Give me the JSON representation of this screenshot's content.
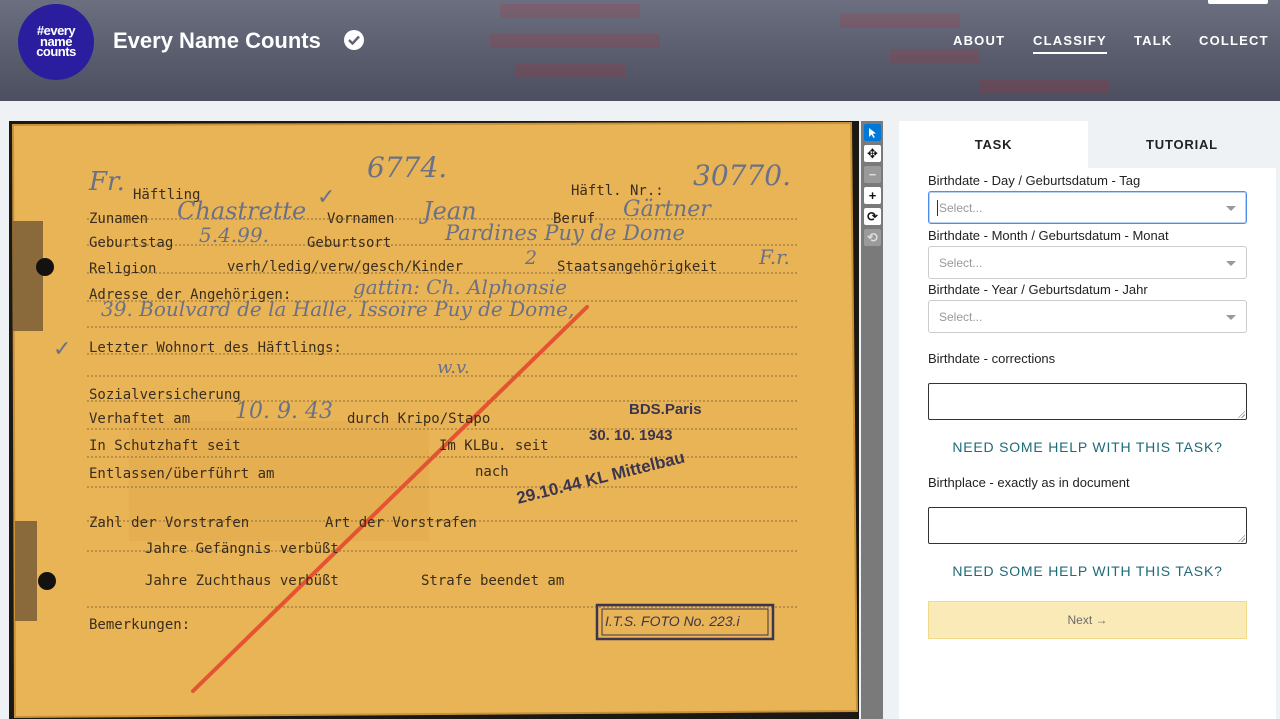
{
  "header": {
    "logo_lines": [
      "#every",
      "name",
      "counts"
    ],
    "project_title": "Every Name Counts",
    "nav": [
      "ABOUT",
      "CLASSIFY",
      "TALK",
      "COLLECT"
    ],
    "active_nav": "CLASSIFY"
  },
  "toolbar": {
    "tools": [
      "pointer",
      "move",
      "zoom-out",
      "zoom-in",
      "rotate",
      "reset"
    ]
  },
  "document": {
    "printed": {
      "haeftling": "Häftling",
      "haeftl_nr": "Häftl. Nr.:",
      "zunamen": "Zunamen",
      "vornamen": "Vornamen",
      "beruf": "Beruf",
      "geburtstag": "Geburtstag",
      "geburtsort": "Geburtsort",
      "religion": "Religion",
      "religion_options": "verh/ledig/verw/gesch/Kinder",
      "staat": "Staatsangehörigkeit",
      "adresse": "Adresse der Angehörigen:",
      "letzter": "Letzter Wohnort des Häftlings:",
      "sozial": "Sozialversicherung",
      "verhaftet": "Verhaftet am",
      "durch": "durch Kripo/Stapo",
      "schutzhaft": "In Schutzhaft seit",
      "klbu": "Im KLBu. seit",
      "entlassen": "Entlassen/überführt am",
      "nach": "nach",
      "zahl": "Zahl der Vorstrafen",
      "art": "Art der Vorstrafen",
      "jahre_gef": "Jahre Gefängnis verbüßt",
      "jahre_zucht": "Jahre Zuchthaus verbüßt",
      "strafe": "Strafe beendet am",
      "bemerkungen": "Bemerkungen:"
    },
    "handwritten": {
      "fr": "Fr.",
      "number_top": "6774.",
      "haeftl_nr_value": "30770.",
      "zuname": "Chastrette",
      "vorname": "Jean",
      "beruf_value": "Gärtner",
      "geburtstag_value": "5.4.99.",
      "geburtsort_value": "Pardines Puy de Dome",
      "kinder": "2",
      "nationality": "F.r.",
      "adresse_line1": "gattin: Ch. Alphonsie",
      "adresse_line2": "39. Boulvard de la Halle, Issoire Puy de Dome,",
      "wohnort": "w.v.",
      "verhaftet_value": "10. 9. 43"
    },
    "stamps": {
      "bds": "BDS.Paris",
      "klbu_date": "30. 10. 1943",
      "transfer": "29.10.44 KL Mittelbau",
      "its": "I.T.S. FOTO No. 223.i"
    }
  },
  "panel": {
    "tabs": [
      "TASK",
      "TUTORIAL"
    ],
    "fields": [
      {
        "label": "Birthdate - Day / Geburtsdatum - Tag",
        "placeholder": "Select..."
      },
      {
        "label": "Birthdate - Month / Geburtsdatum - Monat",
        "placeholder": "Select..."
      },
      {
        "label": "Birthdate - Year / Geburtsdatum - Jahr",
        "placeholder": "Select..."
      }
    ],
    "corrections_label": "Birthdate - corrections",
    "help_text": "NEED SOME HELP WITH THIS TASK?",
    "birthplace_label": "Birthplace - exactly as in document",
    "next_label": "Next →"
  },
  "colors": {
    "header_bg": "#5e6172",
    "logo_bg": "#2a1e9e",
    "card_paper": "#e9b455",
    "help_link": "#1d6b78",
    "next_bg": "#faeab7",
    "focus_border": "#4d8fe8"
  }
}
